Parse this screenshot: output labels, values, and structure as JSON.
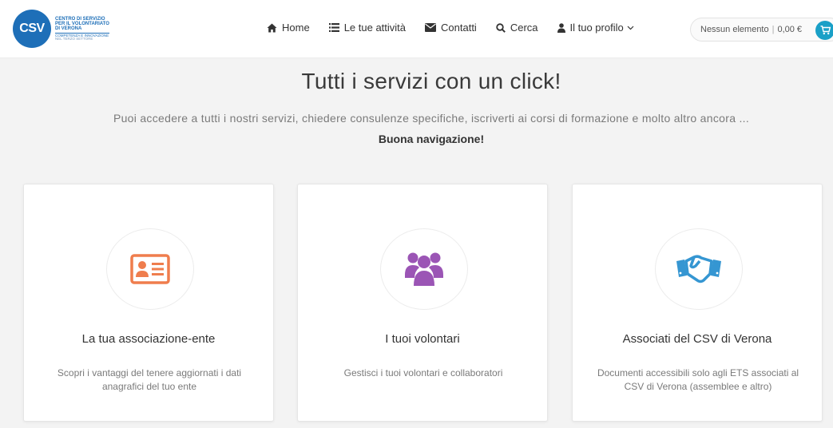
{
  "header": {
    "logo": {
      "mark": "CSV",
      "line1": "CENTRO DI SERVIZIO",
      "line2": "PER IL VOLONTARIATO",
      "line3": "DI VERONA",
      "sub1": "COMPETENZA E INNOVAZIONE",
      "sub2": "NEL TERZO SETTORE"
    },
    "nav": [
      {
        "label": "Home",
        "icon": "home-icon"
      },
      {
        "label": "Le tue attività",
        "icon": "list-icon"
      },
      {
        "label": "Contatti",
        "icon": "envelope-icon"
      },
      {
        "label": "Cerca",
        "icon": "search-icon"
      },
      {
        "label": "Il tuo profilo",
        "icon": "user-icon"
      }
    ],
    "cart": {
      "items": "Nessun elemento",
      "total": "0,00 €",
      "icon": "cart-icon"
    }
  },
  "hero": {
    "title": "Tutti i servizi con un click!",
    "description": "Puoi accedere a tutti i nostri servizi, chiedere consulenze specifiche, iscriverti ai corsi di formazione e molto altro ancora ...",
    "bold": "Buona navigazione!"
  },
  "cards": [
    {
      "title": "La tua associazione-ente",
      "description": "Scopri i vantaggi del tenere aggiornati i dati anagrafici del tuo ente",
      "icon": "id-card-icon",
      "color": "#ef7d4d"
    },
    {
      "title": "I tuoi volontari",
      "description": "Gestisci i tuoi volontari e collaboratori",
      "icon": "users-icon",
      "color": "#9b55b5"
    },
    {
      "title": "Associati del CSV di Verona",
      "description": "Documenti accessibili solo agli ETS associati al CSV di Verona (assemblee e altro)",
      "icon": "handshake-icon",
      "color": "#3596d2"
    }
  ],
  "colors": {
    "brand": "#1e6fb8",
    "cart_accent": "#1aa0c7",
    "background": "#f3f3f3"
  }
}
